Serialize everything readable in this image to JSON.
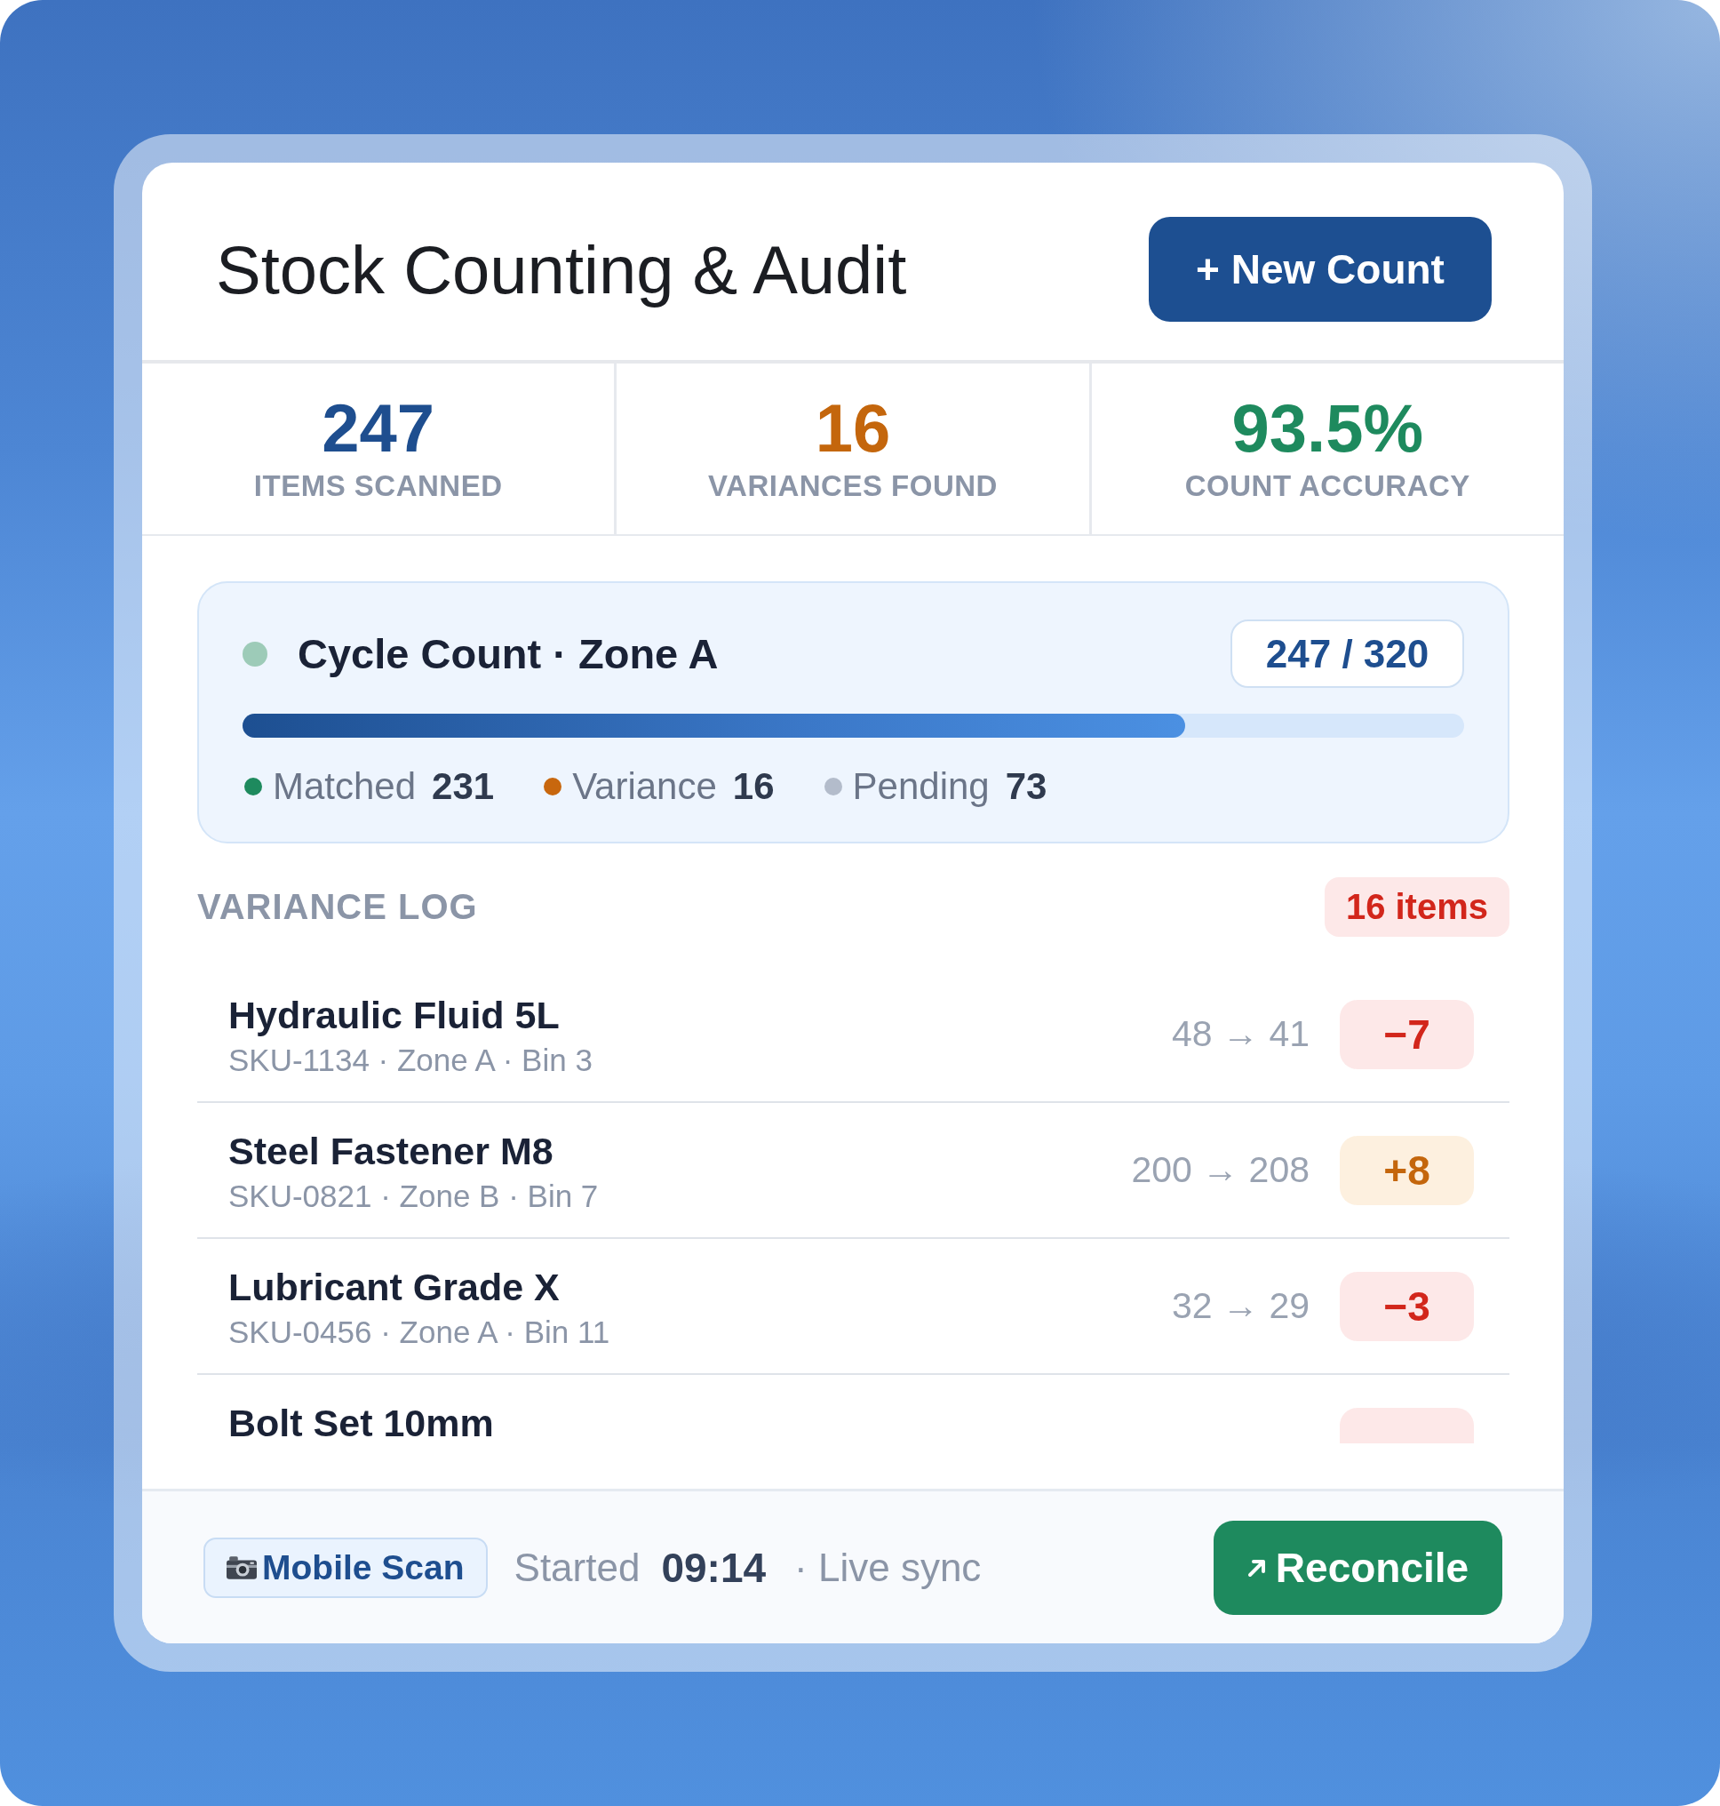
{
  "header": {
    "title": "Stock Counting & Audit",
    "action": "+ New Count"
  },
  "stats": [
    {
      "value": "247",
      "label": "ITEMS SCANNED",
      "color": "#1e4e8f"
    },
    {
      "value": "16",
      "label": "VARIANCES FOUND",
      "color": "#c4660c"
    },
    {
      "value": "93.5%",
      "label": "COUNT ACCURACY",
      "color": "#1e8a5e"
    }
  ],
  "cycle": {
    "title": "Cycle Count · Zone A",
    "progress_text": "247 / 320",
    "level": 0.772,
    "legend": [
      {
        "label": "Matched",
        "count": "231",
        "color": "#1e8a5e"
      },
      {
        "label": "Variance",
        "count": "16",
        "color": "#c8670e"
      },
      {
        "label": "Pending",
        "count": "73",
        "color": "#b3bccb"
      }
    ]
  },
  "variance_log": {
    "title": "VARIANCE LOG",
    "badge": "16 items",
    "rows": [
      {
        "name": "Hydraulic Fluid 5L",
        "details": "SKU-1134 · Zone A · Bin 3",
        "change": "48 → 41",
        "delta": "−7",
        "kind": "shortage"
      },
      {
        "name": "Steel Fastener M8",
        "details": "SKU-0821 · Zone B · Bin 7",
        "change": "200 → 208",
        "delta": "+8",
        "kind": "overage"
      },
      {
        "name": "Lubricant Grade X",
        "details": "SKU-0456 · Zone A · Bin 11",
        "change": "32 → 29",
        "delta": "−3",
        "kind": "shortage"
      },
      {
        "name": "Bolt Set 10mm",
        "kind": "shortage"
      }
    ]
  },
  "footer": {
    "scan_button": "Mobile Scan",
    "started_label": "Started",
    "started_time": "09:14",
    "sync": "· Live sync",
    "action": "Reconcile"
  }
}
